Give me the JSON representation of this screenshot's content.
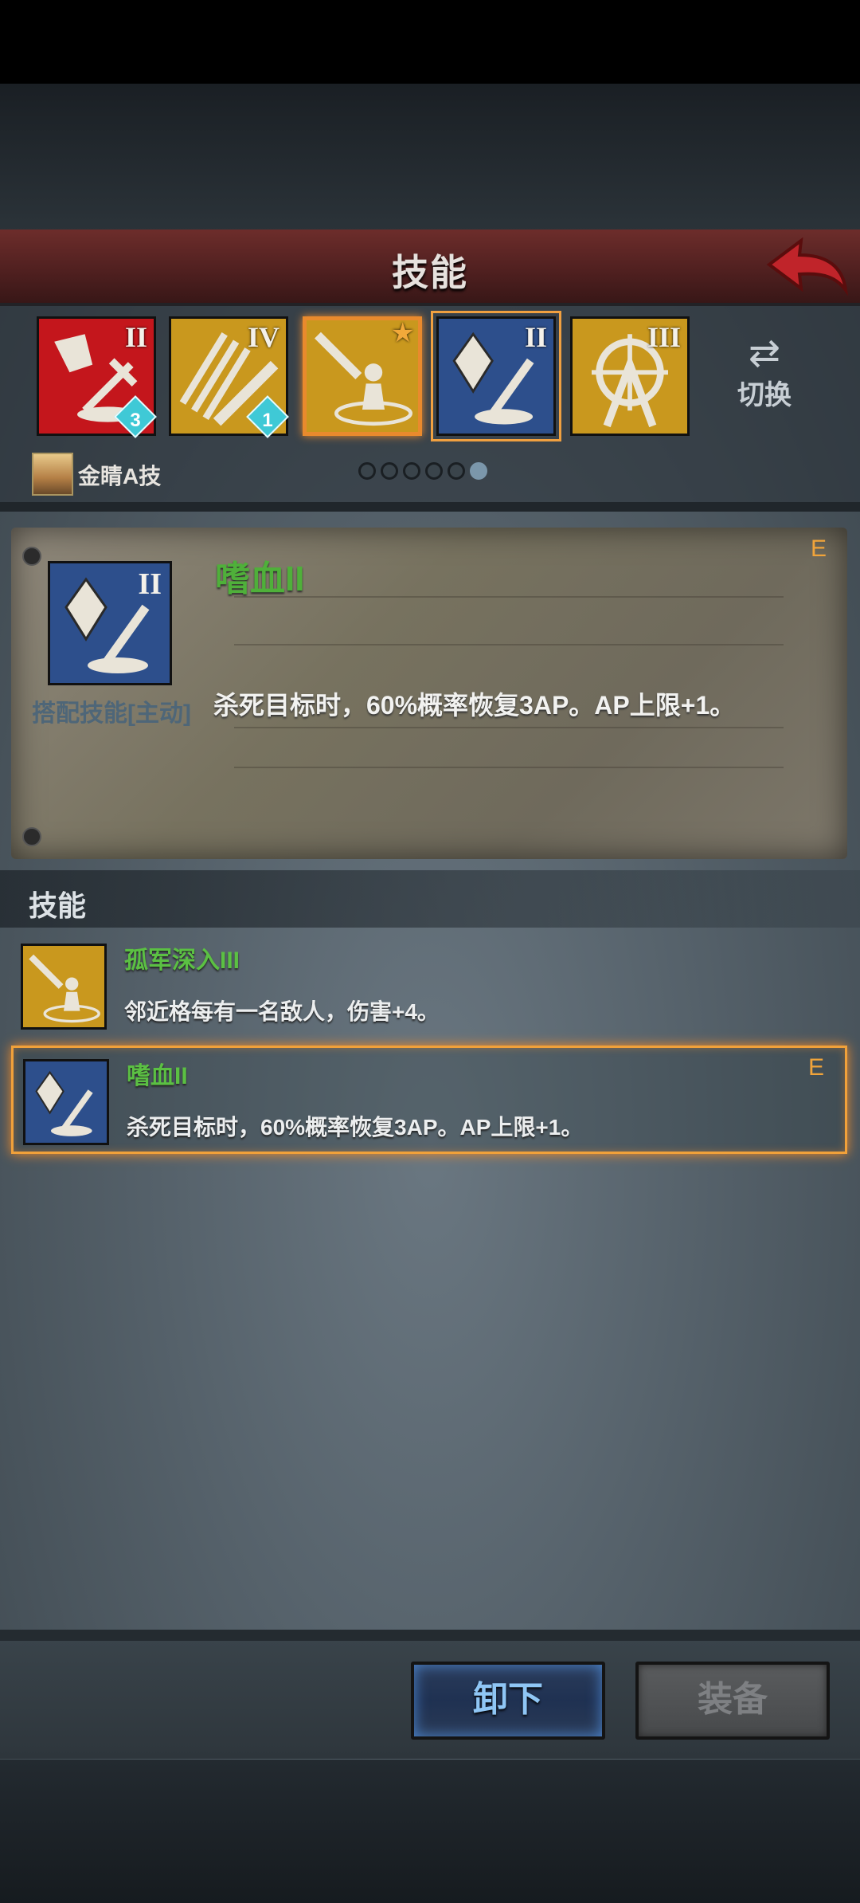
{
  "title": "技能",
  "skill_slots": [
    {
      "roman": "II",
      "gem": "3",
      "bg": "#c4161c"
    },
    {
      "roman": "IV",
      "gem": "1",
      "bg": "#c9981e"
    },
    {
      "roman": "",
      "gem": "",
      "bg": "#c9981e",
      "star": "★"
    },
    {
      "roman": "II",
      "gem": "",
      "bg": "#2d4f8c"
    },
    {
      "roman": "III",
      "gem": "",
      "bg": "#c9981e"
    }
  ],
  "switch_label": "切换",
  "hero_name": "金睛A技",
  "pager": {
    "count": 6,
    "active_index": 5
  },
  "detail": {
    "name": "嗜血II",
    "roman": "II",
    "type_label": "搭配技能[主动]",
    "description": "杀死目标时，60%概率恢复3AP。AP上限+1。",
    "badge": "E"
  },
  "section_title": "技能",
  "skills": [
    {
      "name": "孤军深入III",
      "description": "邻近格每有一名敌人，伤害+4。",
      "badge": ""
    },
    {
      "name": "嗜血II",
      "description": "杀死目标时，60%概率恢复3AP。AP上限+1。",
      "badge": "E"
    }
  ],
  "buttons": {
    "unequip": "卸下",
    "equip": "装备"
  },
  "colors": {
    "skill_name_green": "#4fb03a",
    "selection_orange": "#f1a13a",
    "badge_orange": "#f1a43a"
  }
}
